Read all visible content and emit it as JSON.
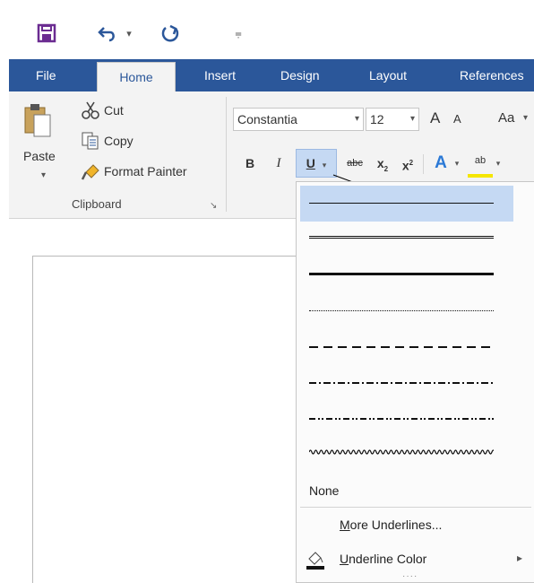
{
  "quick_access": {
    "save_icon": "save-icon",
    "undo_icon": "undo-icon",
    "undo_arrow": "▾",
    "redo_icon": "redo-icon",
    "customize_glyph": "⩦"
  },
  "tabs": [
    {
      "label": "File"
    },
    {
      "label": "Home"
    },
    {
      "label": "Insert"
    },
    {
      "label": "Design"
    },
    {
      "label": "Layout"
    },
    {
      "label": "References"
    }
  ],
  "clipboard": {
    "paste_label": "Paste",
    "cut_label": "Cut",
    "copy_label": "Copy",
    "format_painter_label": "Format Painter",
    "group_label": "Clipboard",
    "launcher_glyph": "↘"
  },
  "font": {
    "name": "Constantia",
    "size": "12",
    "grow": "A",
    "shrink": "A",
    "case": "Aa",
    "bold": "B",
    "italic": "I",
    "underline": "U",
    "strike": "abc",
    "subscript": "x",
    "sub_mark": "2",
    "superscript": "x",
    "sup_mark": "2",
    "text_effects": "A",
    "highlight": "ab",
    "dropdown_glyph": "▾"
  },
  "underline_menu": {
    "styles": [
      "single",
      "double",
      "thick",
      "dotted",
      "dashed",
      "dash-dot",
      "dash-dot-dot",
      "wave"
    ],
    "selected_index": 0,
    "none_label": "None",
    "more_label": "More Underlines...",
    "more_accel": "M",
    "more_rest": "ore Underlines...",
    "color_label": "Underline Color",
    "color_accel": "U",
    "color_rest": "nderline Color",
    "submenu_arrow": "▸",
    "grip": "····"
  }
}
